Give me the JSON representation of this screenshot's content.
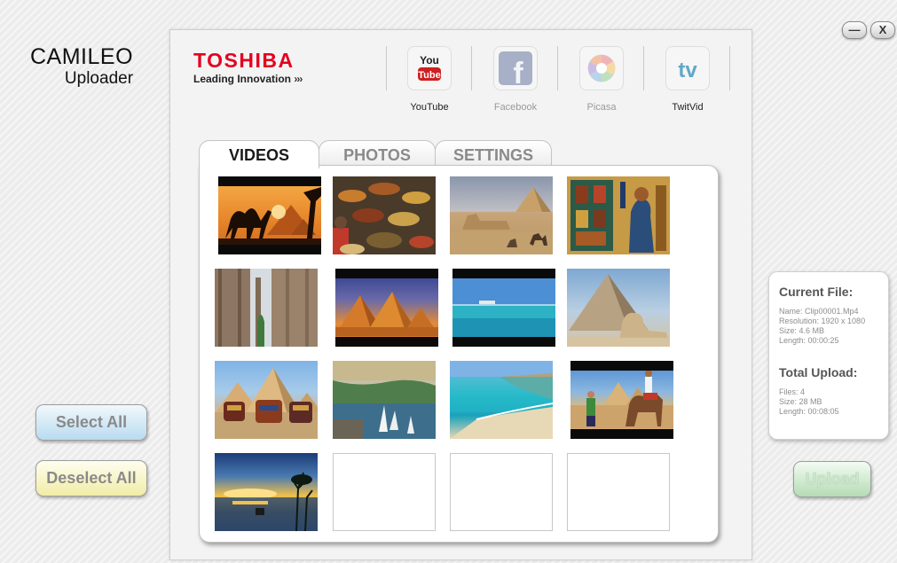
{
  "app": {
    "title_line1": "CAMILEO",
    "title_line2": "Uploader"
  },
  "window_controls": {
    "minimize": "—",
    "close": "X"
  },
  "brand": {
    "name": "TOSHIBA",
    "tagline": "Leading Innovation",
    "tagline_arrows": "›››",
    "color": "#e4001f"
  },
  "services": [
    {
      "name": "YouTube",
      "icon": "youtube-icon",
      "icon_text_top": "You",
      "icon_text_bottom": "Tube",
      "enabled": true
    },
    {
      "name": "Facebook",
      "icon": "facebook-icon",
      "icon_text": "f",
      "enabled": false
    },
    {
      "name": "Picasa",
      "icon": "picasa-icon",
      "enabled": false
    },
    {
      "name": "TwitVid",
      "icon": "twitvid-icon",
      "icon_text": "tv",
      "enabled": false
    }
  ],
  "tabs": [
    {
      "label": "VIDEOS",
      "active": true
    },
    {
      "label": "PHOTOS",
      "active": false
    },
    {
      "label": "SETTINGS",
      "active": false
    }
  ],
  "media_grid": {
    "items": [
      {
        "subject": "camel-silhouette-pyramids-sunset",
        "type": "video",
        "filled": true
      },
      {
        "subject": "spice-market",
        "type": "photo",
        "filled": true
      },
      {
        "subject": "sphinx-pyramids-camels",
        "type": "photo",
        "filled": true
      },
      {
        "subject": "egyptian-wall-paintings",
        "type": "photo",
        "filled": true
      },
      {
        "subject": "temple-columns",
        "type": "photo",
        "filled": true
      },
      {
        "subject": "pyramids-at-dusk",
        "type": "video",
        "filled": true
      },
      {
        "subject": "sea-horizon-ship",
        "type": "video",
        "filled": true
      },
      {
        "subject": "great-sphinx-pyramid",
        "type": "photo",
        "filled": true
      },
      {
        "subject": "camels-before-pyramids",
        "type": "photo",
        "filled": true
      },
      {
        "subject": "nile-feluccas",
        "type": "photo",
        "filled": true
      },
      {
        "subject": "red-sea-beach",
        "type": "photo",
        "filled": true
      },
      {
        "subject": "camel-rider-pyramids",
        "type": "video",
        "filled": true
      },
      {
        "subject": "sunset-over-water-palms",
        "type": "photo",
        "filled": true
      },
      {
        "filled": false
      },
      {
        "filled": false
      },
      {
        "filled": false
      }
    ]
  },
  "buttons": {
    "select_all": "Select All",
    "deselect_all": "Deselect All",
    "upload": "Upload"
  },
  "current_file": {
    "heading": "Current File:",
    "name": "Name: Clip00001.Mp4",
    "resolution": "Resolution: 1920 x 1080",
    "size": "Size: 4.6 MB",
    "length": "Length: 00:00:25"
  },
  "total_upload": {
    "heading": "Total Upload:",
    "files": "Files: 4",
    "size": "Size: 28 MB",
    "length": "Length: 00:08:05"
  }
}
